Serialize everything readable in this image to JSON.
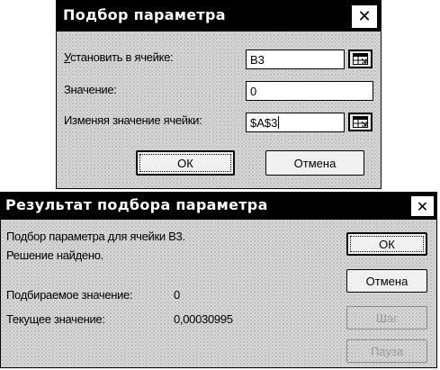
{
  "goal_seek": {
    "title": "Подбор параметра",
    "close_glyph": "✕",
    "set_cell_label": "Установить в ячейке:",
    "set_cell_value": "B3",
    "to_value_label": "Значение:",
    "to_value_value": "0",
    "changing_cell_label": "Изменяя значение ячейки:",
    "changing_cell_value": "$A$3",
    "ok_label": "ОК",
    "cancel_label": "Отмена"
  },
  "goal_seek_status": {
    "title": "Результат подбора параметра",
    "close_glyph": "✕",
    "status_line1": "Подбор параметра для ячейки B3.",
    "status_line2": "Решение найдено.",
    "target_value_label": "Подбираемое значение:",
    "target_value": "0",
    "current_value_label": "Текущее значение:",
    "current_value": "0,00030995",
    "ok_label": "ОК",
    "cancel_label": "Отмена",
    "step_label": "Шаг",
    "pause_label": "Пауза"
  }
}
